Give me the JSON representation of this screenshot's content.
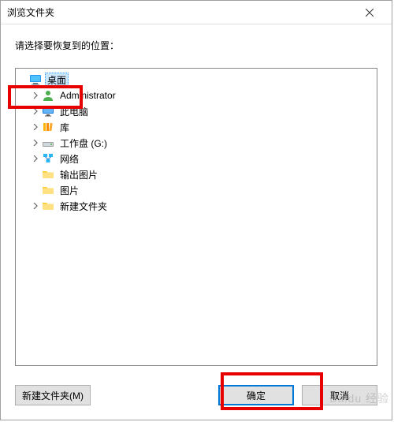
{
  "titlebar": {
    "title": "浏览文件夹"
  },
  "instruction": "请选择要恢复到的位置：",
  "tree": {
    "root": {
      "label": "桌面",
      "icon": "desktop"
    },
    "items": [
      {
        "label": "Administrator",
        "icon": "user",
        "expandable": true
      },
      {
        "label": "此电脑",
        "icon": "pc",
        "expandable": true
      },
      {
        "label": "库",
        "icon": "libs",
        "expandable": true
      },
      {
        "label": "工作盘 (G:)",
        "icon": "drive",
        "expandable": true
      },
      {
        "label": "网络",
        "icon": "network",
        "expandable": true
      },
      {
        "label": "输出图片",
        "icon": "folder",
        "expandable": false
      },
      {
        "label": "图片",
        "icon": "folder",
        "expandable": false
      },
      {
        "label": "新建文件夹",
        "icon": "folder",
        "expandable": true
      }
    ]
  },
  "buttons": {
    "new_folder": "新建文件夹(M)",
    "ok": "确定",
    "cancel": "取消"
  },
  "watermark": "Baidu 经验"
}
